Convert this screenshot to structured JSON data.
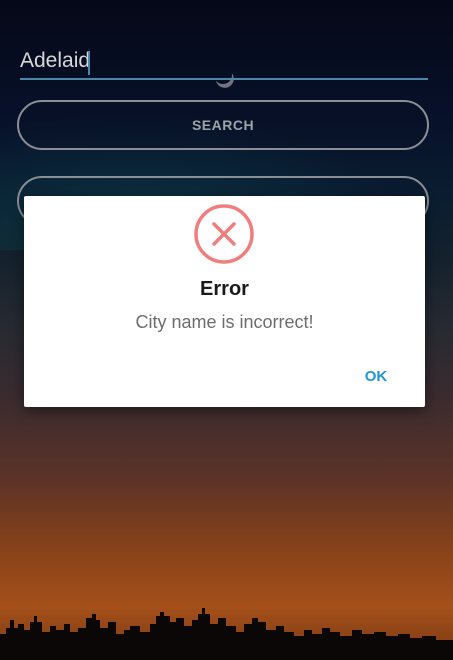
{
  "search": {
    "city_value": "Adelaid",
    "button_label": "SEARCH"
  },
  "dialog": {
    "icon": "error-x-circle-icon",
    "title": "Error",
    "message": "City name is incorrect!",
    "ok_label": "OK"
  },
  "colors": {
    "accent": "#2196d3",
    "error": "#ef7f7f",
    "input_underline": "#4a87a8"
  }
}
